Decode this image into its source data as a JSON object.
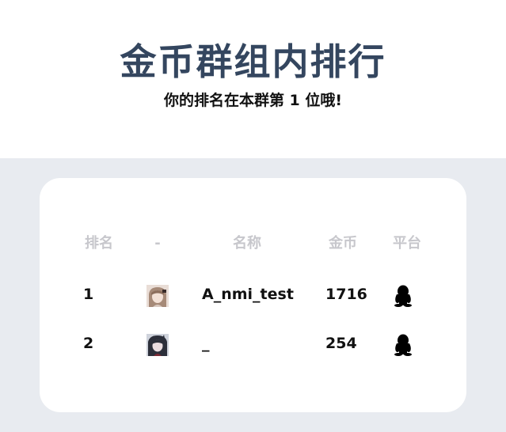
{
  "header": {
    "title": "金币群组内排行",
    "subtitle": "你的排名在本群第 1 位哦!"
  },
  "table": {
    "columns": {
      "rank": "排名",
      "avatar": "-",
      "name": "名称",
      "coins": "金币",
      "platform": "平台"
    },
    "rows": [
      {
        "rank": "1",
        "name": "A_nmi_test",
        "coins": "1716",
        "platform_icon": "qq-penguin-icon"
      },
      {
        "rank": "2",
        "name": "_",
        "coins": "254",
        "platform_icon": "qq-penguin-icon"
      }
    ]
  },
  "colors": {
    "title": "#34465f",
    "background_band": "#e8ebf0",
    "header_text": "#c7c7cc"
  }
}
